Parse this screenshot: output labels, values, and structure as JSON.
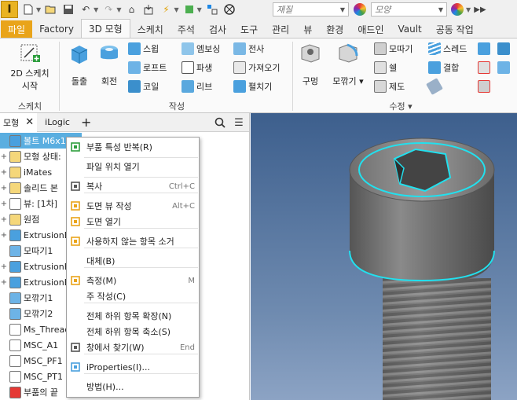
{
  "app": {
    "logo": "I"
  },
  "qat": {
    "material_placeholder": "재질",
    "appearance_placeholder": "모양",
    "icons": [
      "new-icon",
      "open-icon",
      "save-icon",
      "undo-icon",
      "redo-icon",
      "home-icon",
      "return-icon",
      "update-icon",
      "select-icon",
      "parameters-icon",
      "no-material-icon",
      "color-wheel-icon",
      "overflow-icon"
    ]
  },
  "tabs": [
    "파일",
    "Factory",
    "3D 모형",
    "스케치",
    "주석",
    "검사",
    "도구",
    "관리",
    "뷰",
    "환경",
    "애드인",
    "Vault",
    "공동 작업"
  ],
  "ribbon": {
    "sketch": {
      "btn1": "2D 스케치",
      "btn2": "시작",
      "label": "스케치"
    },
    "create": {
      "extrude": "돌출",
      "revolve": "회전",
      "sweep": "스윕",
      "loft": "로프트",
      "coil": "코일",
      "emboss": "엠보싱",
      "derive": "파생",
      "rib": "리브",
      "decal": "전사",
      "import": "가져오기",
      "unfold": "펼치기",
      "label": "작성"
    },
    "modify": {
      "hole": "구멍",
      "fillet": "모깎기",
      "chamfer": "모따기",
      "shell": "쉘",
      "draft": "제도",
      "thread": "스레드",
      "combine": "결합",
      "label": "수정"
    }
  },
  "browser": {
    "tabs": [
      "모형",
      "iLogic"
    ],
    "rows": [
      "볼트 M6x16 IS",
      "모형 상태:",
      "iMates",
      "솔리드 본",
      "뷰: [1차]",
      "원점",
      "ExtrusionB",
      "모따기1",
      "ExtrusionB",
      "ExtrusionB",
      "모깎기1",
      "모깎기2",
      "Ms_Thread",
      "MSC_A1",
      "MSC_PF1",
      "MSC_PT1",
      "부품의 끝"
    ]
  },
  "context_menu": {
    "items": [
      {
        "label": "부품 특성 반복(R)",
        "shortcut": ""
      },
      {
        "label": "파일 위치 열기",
        "shortcut": ""
      },
      {
        "label": "복사",
        "shortcut": "Ctrl+C"
      },
      {
        "label": "도면 뷰 작성",
        "shortcut": "Alt+C"
      },
      {
        "label": "도면 열기",
        "shortcut": ""
      },
      {
        "label": "사용하지 않는 항목 소거",
        "shortcut": ""
      },
      {
        "label": "대체(B)",
        "shortcut": ""
      },
      {
        "label": "측정(M)",
        "shortcut": "M"
      },
      {
        "label": "주 작성(C)",
        "shortcut": ""
      },
      {
        "label": "전체 하위 항목 확장(N)",
        "shortcut": ""
      },
      {
        "label": "전체 하위 항목 축소(S)",
        "shortcut": ""
      },
      {
        "label": "창에서 찾기(W)",
        "shortcut": "End"
      },
      {
        "label": "iProperties(I)...",
        "shortcut": ""
      },
      {
        "label": "방법(H)...",
        "shortcut": ""
      }
    ]
  },
  "colors": {
    "accent": "#e9a41a",
    "selection": "#5aaee0",
    "highlight": "#22e0ee",
    "viewport_top": "#3d5f8d"
  }
}
